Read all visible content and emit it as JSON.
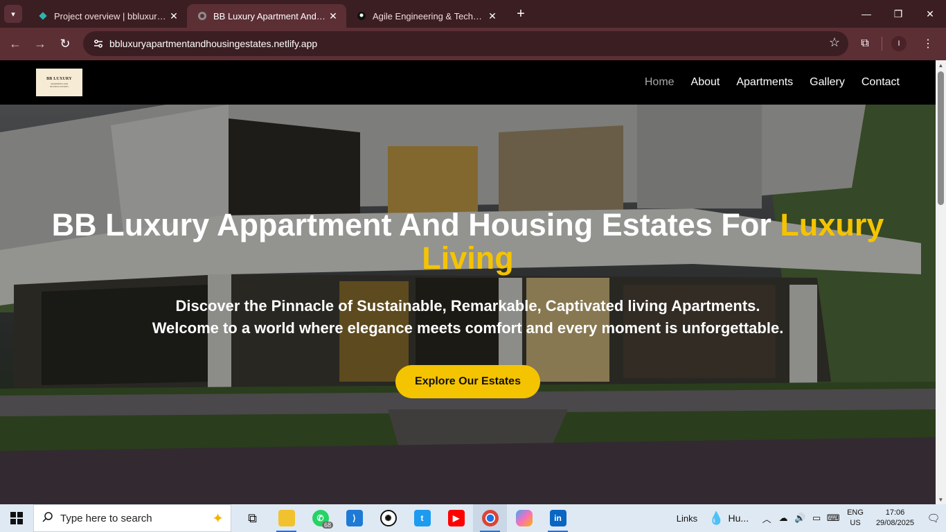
{
  "browser": {
    "tabs": [
      {
        "title": "Project overview | bbluxuryapar",
        "favicon": "netlify-diamond-icon",
        "active": false
      },
      {
        "title": "BB Luxury Apartment And Hous",
        "favicon": "globe-icon",
        "active": true
      },
      {
        "title": "Agile Engineering & Technical S",
        "favicon": "github-icon",
        "active": false
      }
    ],
    "new_tab_label": "+",
    "url": "bbluxuryapartmentandhousingestates.netlify.app",
    "profile_initial": "I",
    "window_controls": {
      "minimize": "—",
      "maximize": "❐",
      "close": "✕"
    }
  },
  "site": {
    "logo": {
      "line1": "BB LUXURY",
      "line2": "APARTMENT AND",
      "line3": "HOUSING ESTATES"
    },
    "nav": [
      {
        "label": "Home",
        "current": true
      },
      {
        "label": "About",
        "current": false
      },
      {
        "label": "Apartments",
        "current": false
      },
      {
        "label": "Gallery",
        "current": false
      },
      {
        "label": "Contact",
        "current": false
      }
    ],
    "hero": {
      "title_main": "BB Luxury Appartment And Housing Estates For ",
      "title_accent": "Luxury Living",
      "subtitle_line1": "Discover the Pinnacle of Sustainable, Remarkable, Captivated living Apartments.",
      "subtitle_line2": "Welcome to a world where elegance meets comfort and every moment is unforgettable.",
      "cta_label": "Explore Our Estates"
    },
    "colors": {
      "accent": "#f5c400",
      "nav_bg": "#000000",
      "current_nav": "#a9a9a9"
    }
  },
  "taskbar": {
    "search_placeholder": "Type here to search",
    "apps": [
      {
        "name": "task-view-icon",
        "running": false
      },
      {
        "name": "file-explorer-icon",
        "running": true
      },
      {
        "name": "whatsapp-icon",
        "running": false,
        "badge": "68"
      },
      {
        "name": "vscode-icon",
        "running": false
      },
      {
        "name": "chatgpt-icon",
        "running": false
      },
      {
        "name": "twitter-icon",
        "running": false
      },
      {
        "name": "youtube-icon",
        "running": false
      },
      {
        "name": "chrome-icon",
        "running": true
      },
      {
        "name": "copilot-icon",
        "running": false
      },
      {
        "name": "linkedin-icon",
        "running": true
      }
    ],
    "links_label": "Links",
    "weather_label": "Hu...",
    "lang_line1": "ENG",
    "lang_line2": "US",
    "time": "17:06",
    "date": "29/08/2025"
  }
}
